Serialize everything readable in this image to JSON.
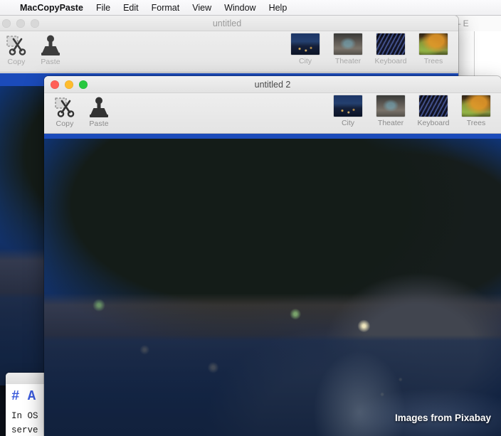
{
  "menubar": {
    "apple_glyph": "",
    "items": [
      {
        "label": "MacCopyPaste",
        "name": "menu-app"
      },
      {
        "label": "File",
        "name": "menu-file"
      },
      {
        "label": "Edit",
        "name": "menu-edit"
      },
      {
        "label": "Format",
        "name": "menu-format"
      },
      {
        "label": "View",
        "name": "menu-view"
      },
      {
        "label": "Window",
        "name": "menu-window"
      },
      {
        "label": "Help",
        "name": "menu-help"
      }
    ]
  },
  "window_back": {
    "title": "untitled",
    "toolbar": {
      "copy_label": "Copy",
      "paste_label": "Paste",
      "thumbnails": [
        {
          "label": "City"
        },
        {
          "label": "Theater"
        },
        {
          "label": "Keyboard"
        },
        {
          "label": "Trees"
        }
      ]
    }
  },
  "window_front": {
    "title": "untitled 2",
    "toolbar": {
      "copy_label": "Copy",
      "paste_label": "Paste",
      "thumbnails": [
        {
          "label": "City"
        },
        {
          "label": "Theater"
        },
        {
          "label": "Keyboard"
        },
        {
          "label": "Trees"
        }
      ]
    },
    "photo_caption": "Images from Pixabay"
  },
  "editor_window": {
    "title": "x.md — E"
  },
  "markdown_preview": {
    "heading": "# A",
    "line1": "In OS",
    "line2": "serve"
  },
  "colors": {
    "accent_blue": "#1b4bba",
    "menubar_bg": "#f5f5f7",
    "toolbar_bg": "#e9e9e9",
    "traffic_red": "#ff5f57",
    "traffic_yellow": "#febc2e",
    "traffic_green": "#28c840"
  }
}
